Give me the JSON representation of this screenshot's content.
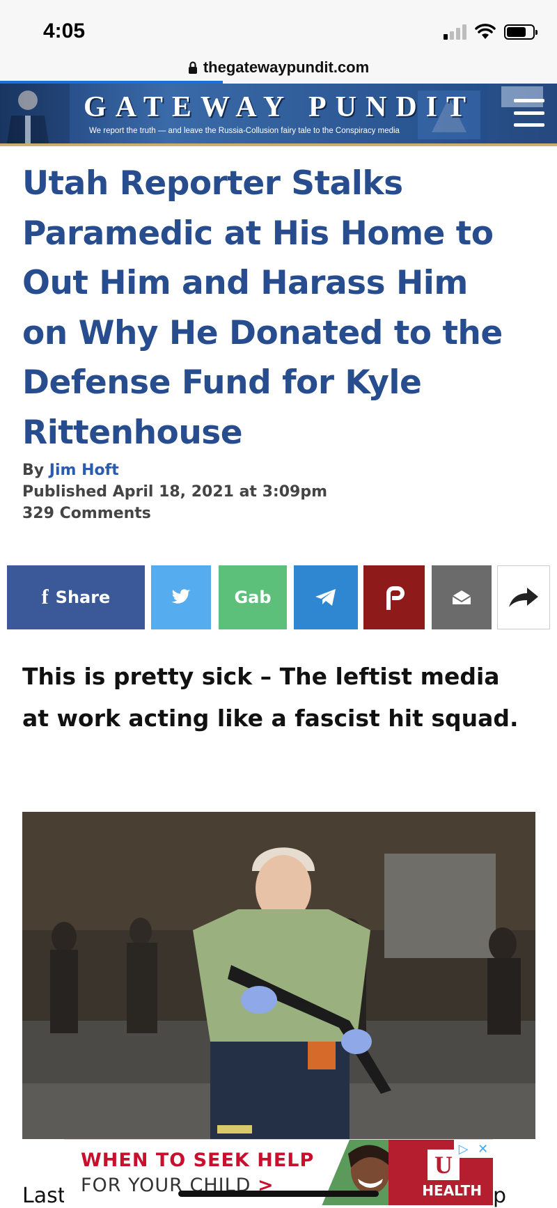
{
  "status_bar": {
    "time": "4:05",
    "icons": [
      "cellular-signal-icon",
      "wifi-icon",
      "battery-icon"
    ]
  },
  "browser": {
    "url": "thegatewaypundit.com",
    "icons": [
      "lock-icon"
    ]
  },
  "site_header": {
    "logo_title": "GATEWAY PUNDIT",
    "tagline": "We report the truth — and leave the Russia-Collusion fairy tale to the Conspiracy media",
    "menu_icon": "hamburger-menu-icon"
  },
  "article": {
    "headline": "Utah Reporter Stalks Paramedic at His Home to Out Him and Harass Him on Why He Donated to the Defense Fund for Kyle Rittenhouse",
    "by_label": "By",
    "author": "Jim Hoft",
    "published": "Published April 18, 2021 at 3:09pm",
    "comments": "329 Comments",
    "lede": "This is pretty sick – The leftist media at work acting like a fascist hit squad.",
    "body_start": "Last",
    "body_end": "p"
  },
  "share_buttons": [
    {
      "name": "facebook",
      "label": "Share",
      "icon": "facebook-icon",
      "color": "#3b5998"
    },
    {
      "name": "twitter",
      "label": "",
      "icon": "twitter-bird-icon",
      "color": "#55acee"
    },
    {
      "name": "gab",
      "label": "Gab",
      "icon": "",
      "color": "#5dc07a"
    },
    {
      "name": "telegram",
      "label": "",
      "icon": "telegram-plane-icon",
      "color": "#2f86d1"
    },
    {
      "name": "parler",
      "label": "",
      "icon": "parler-p-icon",
      "color": "#8e1a1a"
    },
    {
      "name": "email",
      "label": "",
      "icon": "envelope-icon",
      "color": "#6b6b6b"
    },
    {
      "name": "more",
      "label": "",
      "icon": "share-arrow-icon",
      "color": "#ffffff"
    }
  ],
  "ad": {
    "line1": "WHEN TO SEEK HELP",
    "line2": "FOR YOUR CHILD",
    "line2_chevron": ">",
    "brand": "HEALTH",
    "logo_letter": "U",
    "icons": [
      "adchoices-icon",
      "close-icon"
    ]
  },
  "colors": {
    "headline": "#284d8f",
    "link": "#2a5bb0",
    "header_blue": "#2f5c98",
    "ad_red": "#c8102e"
  }
}
